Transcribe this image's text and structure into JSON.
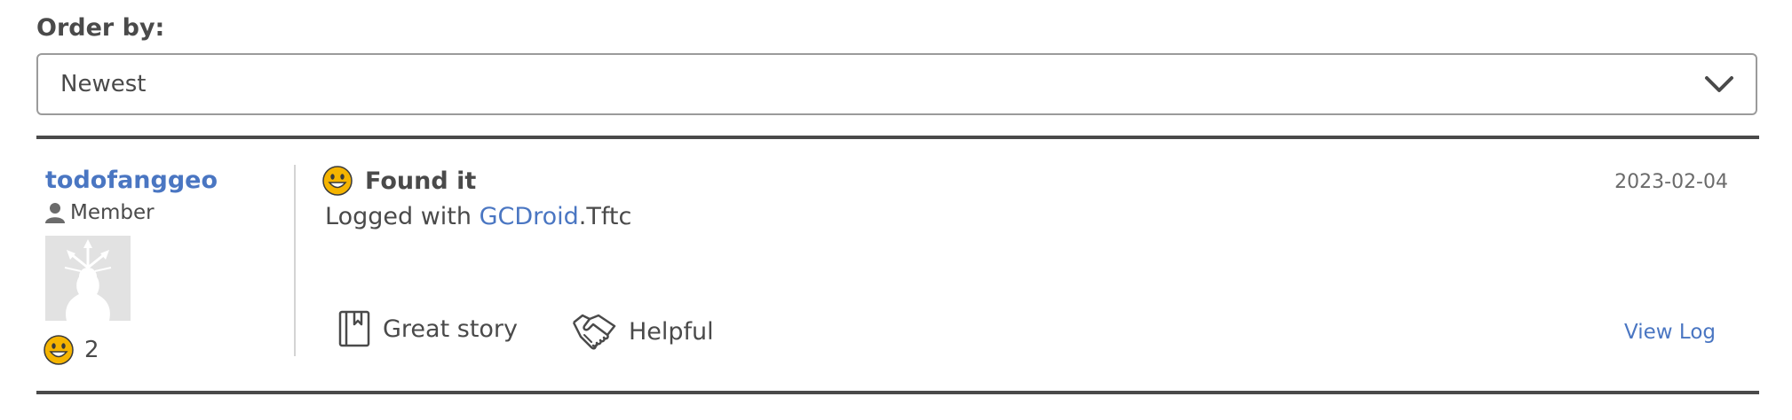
{
  "order": {
    "label": "Order by:",
    "selected": "Newest"
  },
  "log": {
    "username": "todofanggeo",
    "role": "Member",
    "finds_count": "2",
    "type": "Found it",
    "date": "2023-02-04",
    "text_prefix": "Logged with ",
    "link_text": "GCDroid",
    "text_suffix": ".Tftc",
    "reactions": {
      "great_story": "Great story",
      "helpful": "Helpful"
    },
    "view_log": "View Log"
  },
  "icons": {
    "dropdown": "chevron-down-icon",
    "member": "person-icon",
    "found": "smiley-icon",
    "great_story": "bookmark-book-icon",
    "helpful": "handshake-icon"
  },
  "colors": {
    "link": "#4a76c2",
    "text": "#4a4a4a",
    "smiley": "#f5b400"
  }
}
